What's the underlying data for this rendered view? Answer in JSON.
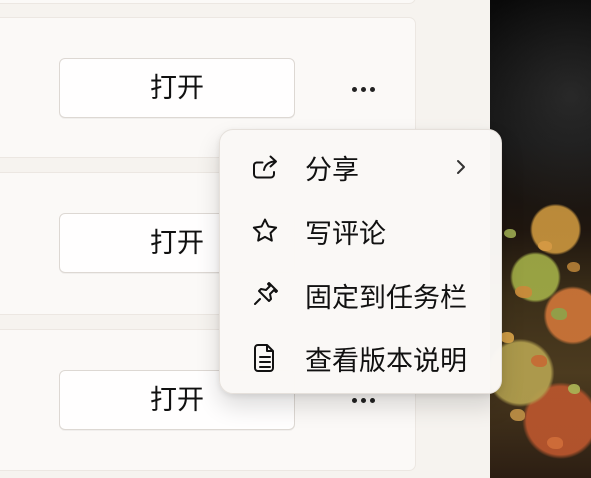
{
  "list": {
    "rows": [
      {
        "open_label": "打开"
      },
      {
        "open_label": "打开"
      },
      {
        "open_label": "打开"
      }
    ]
  },
  "menu": {
    "items": [
      {
        "label": "分享",
        "icon": "share-icon",
        "has_submenu": true
      },
      {
        "label": "写评论",
        "icon": "star-icon"
      },
      {
        "label": "固定到任务栏",
        "icon": "pin-icon"
      },
      {
        "label": "查看版本说明",
        "icon": "document-icon"
      }
    ]
  },
  "colors": {
    "page_bg": "#f6f3ef",
    "card_bg": "#fbf9f7",
    "menu_bg": "#faf8f6",
    "text": "#111111",
    "border": "#ddd8d3"
  }
}
